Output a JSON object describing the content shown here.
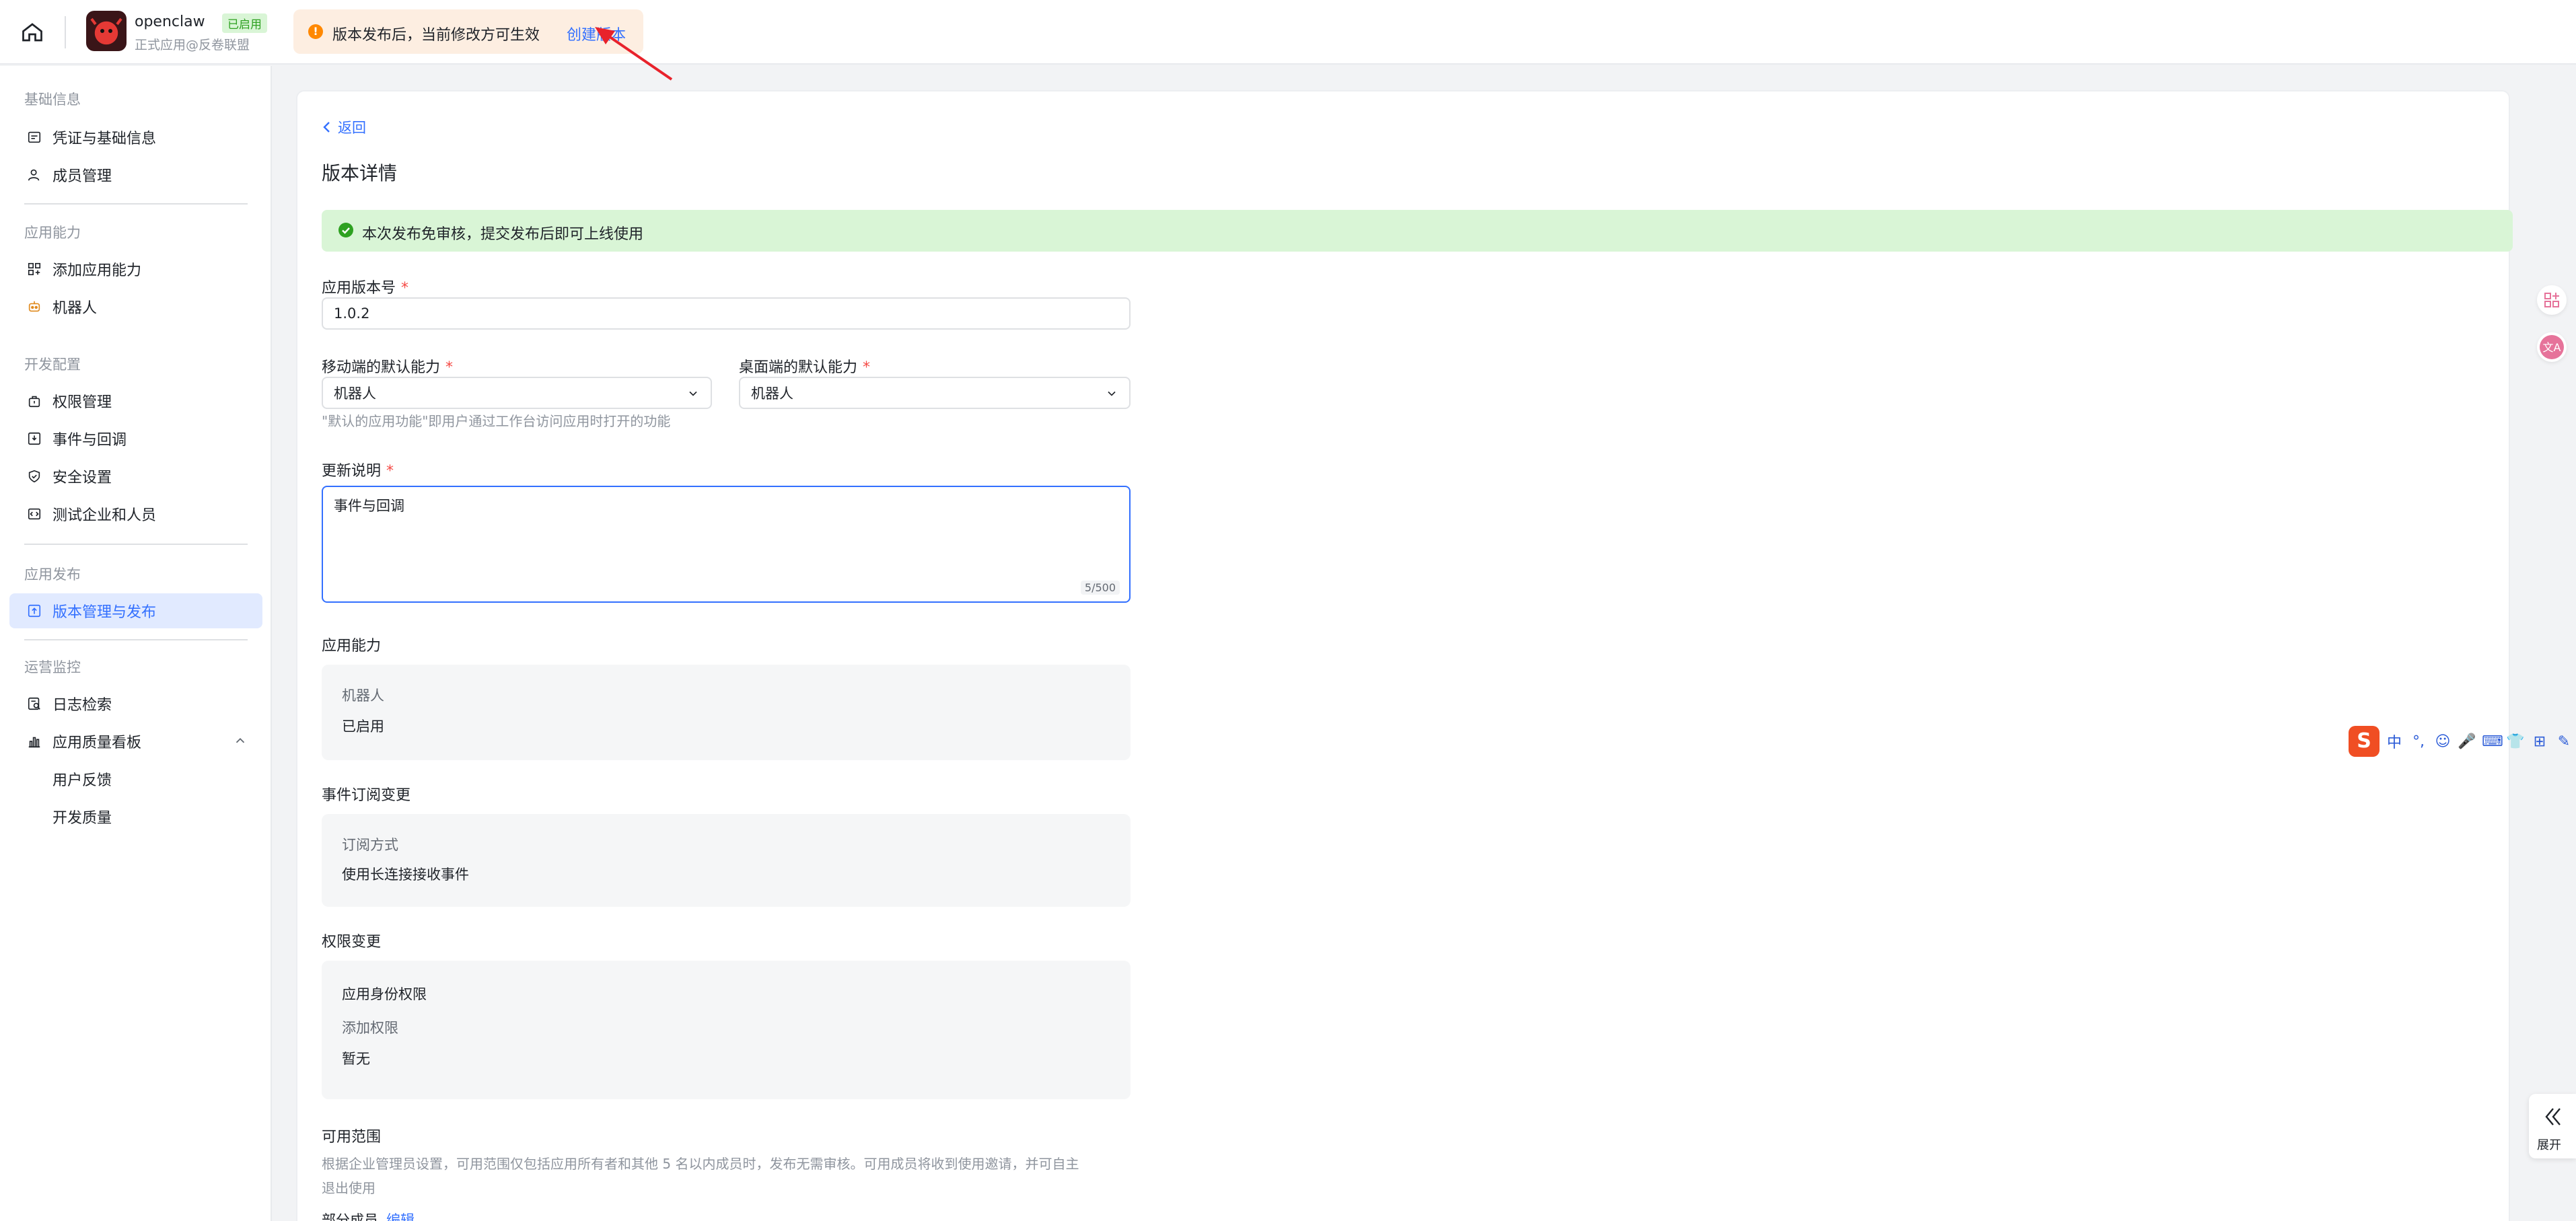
{
  "header": {
    "app_name": "openclaw",
    "app_status": "已启用",
    "app_subtitle": "正式应用@反卷联盟",
    "notice_text": "版本发布后，当前修改方可生效",
    "notice_link": "创建版本"
  },
  "sidebar": {
    "sections": [
      {
        "title": "基础信息",
        "items": [
          "凭证与基础信息",
          "成员管理"
        ]
      },
      {
        "title": "应用能力",
        "items": [
          "添加应用能力",
          "机器人"
        ]
      },
      {
        "title": "开发配置",
        "items": [
          "权限管理",
          "事件与回调",
          "安全设置",
          "测试企业和人员"
        ]
      },
      {
        "title": "应用发布",
        "items": [
          "版本管理与发布"
        ]
      },
      {
        "title": "运营监控",
        "items": [
          "日志检索",
          "应用质量看板",
          "用户反馈",
          "开发质量"
        ]
      }
    ]
  },
  "main": {
    "back_label": "返回",
    "title": "版本详情",
    "success_text": "本次发布免审核，提交发布后即可上线使用",
    "version_label": "应用版本号",
    "version_value": "1.0.2",
    "mobile_label": "移动端的默认能力",
    "mobile_value": "机器人",
    "desktop_label": "桌面端的默认能力",
    "desktop_value": "机器人",
    "default_hint": "\"默认的应用功能\"即用户通过工作台访问应用时打开的功能",
    "notes_label": "更新说明",
    "notes_value": "事件与回调",
    "notes_counter": "5/500",
    "capability_title": "应用能力",
    "capability_key": "机器人",
    "capability_value": "已启用",
    "event_title": "事件订阅变更",
    "event_key": "订阅方式",
    "event_value": "使用长连接接收事件",
    "perm_title": "权限变更",
    "perm_group": "应用身份权限",
    "perm_key": "添加权限",
    "perm_value": "暂无",
    "scope_title": "可用范围",
    "scope_desc_1": "根据企业管理员设置，可用范围仅包括应用所有者和其他 5 名以内成员时，发布无需审核。可用成员将收到使用邀请，并可自主",
    "scope_desc_2": "退出使用",
    "scope_partial": "部分成员",
    "scope_edit": "编辑"
  },
  "ime": {
    "items": [
      "中",
      "°,",
      "☺",
      "🎤",
      "⌨",
      "👕",
      "⊞",
      "✎"
    ]
  },
  "expand_label": "展开",
  "colors": {
    "accent": "#3370ff",
    "success_bg": "#d9f5d6",
    "notice_bg": "#fdeee1",
    "active_bg": "#e1eaff",
    "required": "#f54a45"
  }
}
